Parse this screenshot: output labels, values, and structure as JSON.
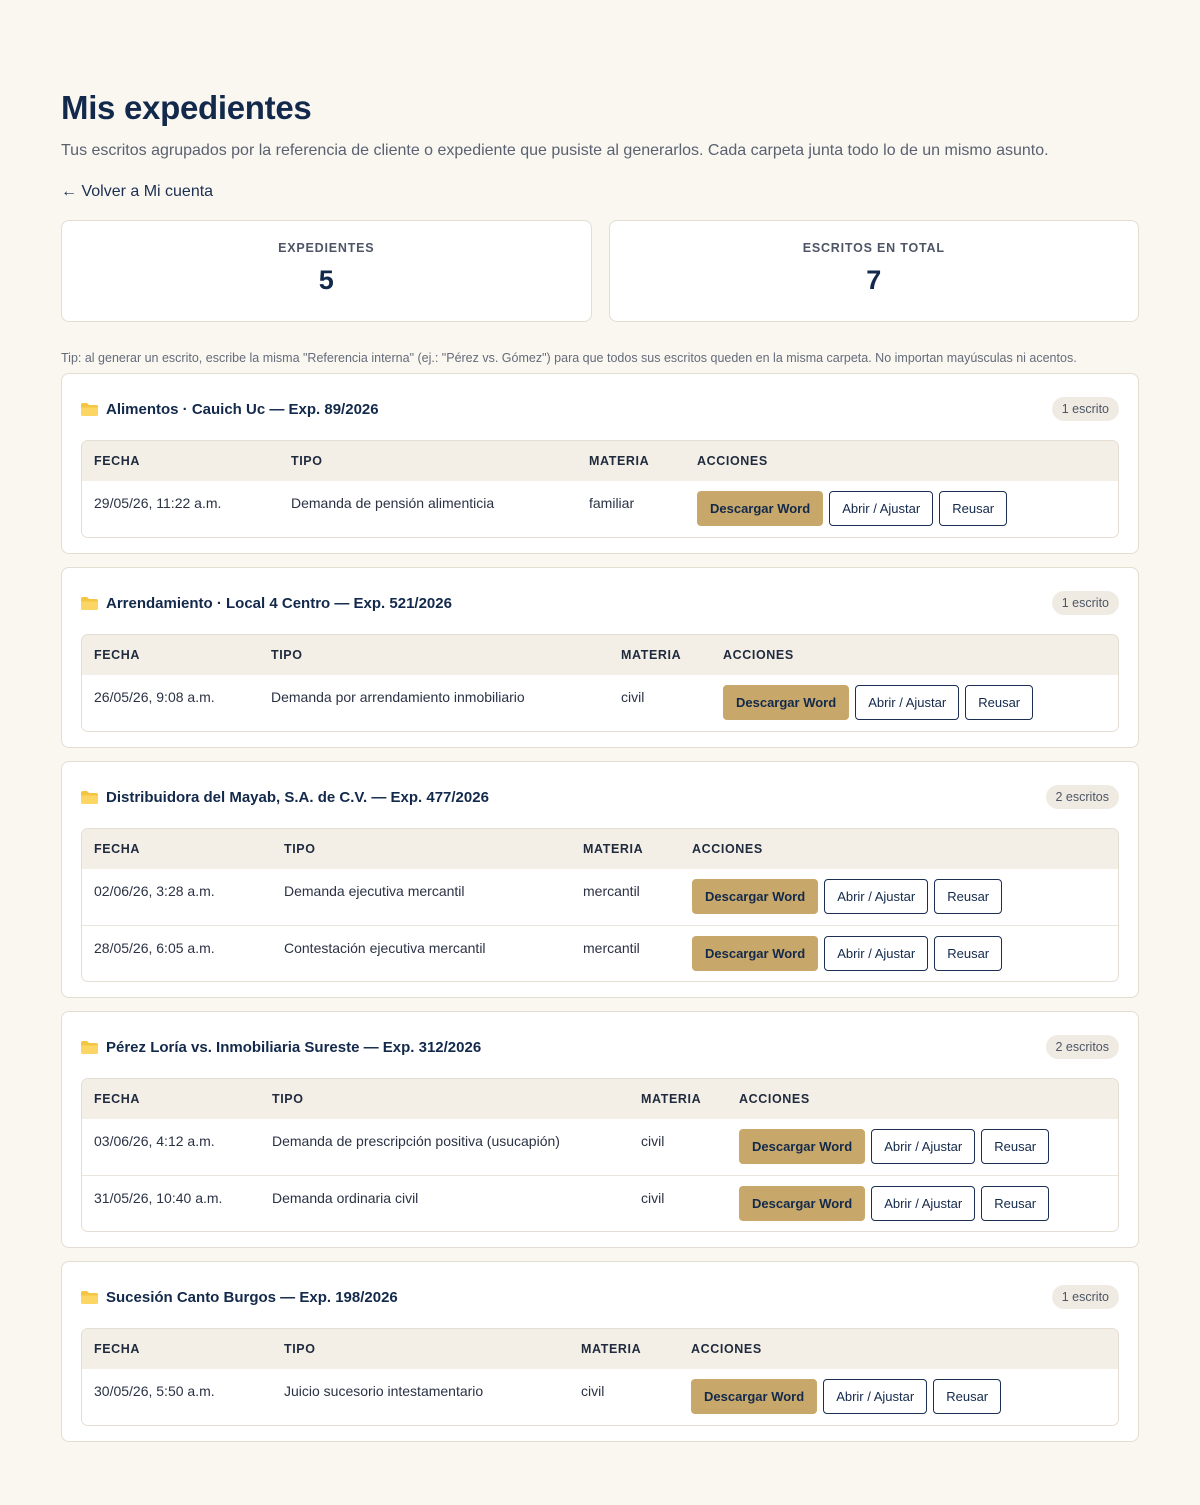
{
  "header": {
    "title": "Mis expedientes",
    "subtitle": "Tus escritos agrupados por la referencia de cliente o expediente que pusiste al generarlos. Cada carpeta junta todo lo de un mismo asunto.",
    "back_link": "← Volver a Mi cuenta"
  },
  "stats": {
    "expedientes_label": "EXPEDIENTES",
    "expedientes_value": "5",
    "escritos_label": "ESCRITOS EN TOTAL",
    "escritos_value": "7"
  },
  "tip": "Tip: al generar un escrito, escribe la misma \"Referencia interna\" (ej.: \"Pérez vs. Gómez\") para que todos sus escritos queden en la misma carpeta. No importan mayúsculas ni acentos.",
  "table_headers": {
    "fecha": "FECHA",
    "tipo": "TIPO",
    "materia": "MATERIA",
    "acciones": "ACCIONES"
  },
  "buttons": {
    "download": "Descargar Word",
    "open": "Abrir / Ajustar",
    "reuse": "Reusar"
  },
  "colors": {
    "accent": "#c8a86a",
    "navy": "#13294b",
    "background": "#faf7f1"
  },
  "folders": [
    {
      "title": "Alimentos · Cauich Uc — Exp. 89/2026",
      "count": "1 escrito",
      "rows": [
        {
          "fecha": "29/05/26, 11:22 a.m.",
          "tipo": "Demanda de pensión alimenticia",
          "materia": "familiar"
        }
      ]
    },
    {
      "title": "Arrendamiento · Local 4 Centro — Exp. 521/2026",
      "count": "1 escrito",
      "rows": [
        {
          "fecha": "26/05/26, 9:08 a.m.",
          "tipo": "Demanda por arrendamiento inmobiliario",
          "materia": "civil"
        }
      ]
    },
    {
      "title": "Distribuidora del Mayab, S.A. de C.V. — Exp. 477/2026",
      "count": "2 escritos",
      "rows": [
        {
          "fecha": "02/06/26, 3:28 a.m.",
          "tipo": "Demanda ejecutiva mercantil",
          "materia": "mercantil"
        },
        {
          "fecha": "28/05/26, 6:05 a.m.",
          "tipo": "Contestación ejecutiva mercantil",
          "materia": "mercantil"
        }
      ]
    },
    {
      "title": "Pérez Loría vs. Inmobiliaria Sureste — Exp. 312/2026",
      "count": "2 escritos",
      "rows": [
        {
          "fecha": "03/06/26, 4:12 a.m.",
          "tipo": "Demanda de prescripción positiva (usucapión)",
          "materia": "civil"
        },
        {
          "fecha": "31/05/26, 10:40 a.m.",
          "tipo": "Demanda ordinaria civil",
          "materia": "civil"
        }
      ]
    },
    {
      "title": "Sucesión Canto Burgos — Exp. 198/2026",
      "count": "1 escrito",
      "rows": [
        {
          "fecha": "30/05/26, 5:50 a.m.",
          "tipo": "Juicio sucesorio intestamentario",
          "materia": "civil"
        }
      ]
    }
  ]
}
